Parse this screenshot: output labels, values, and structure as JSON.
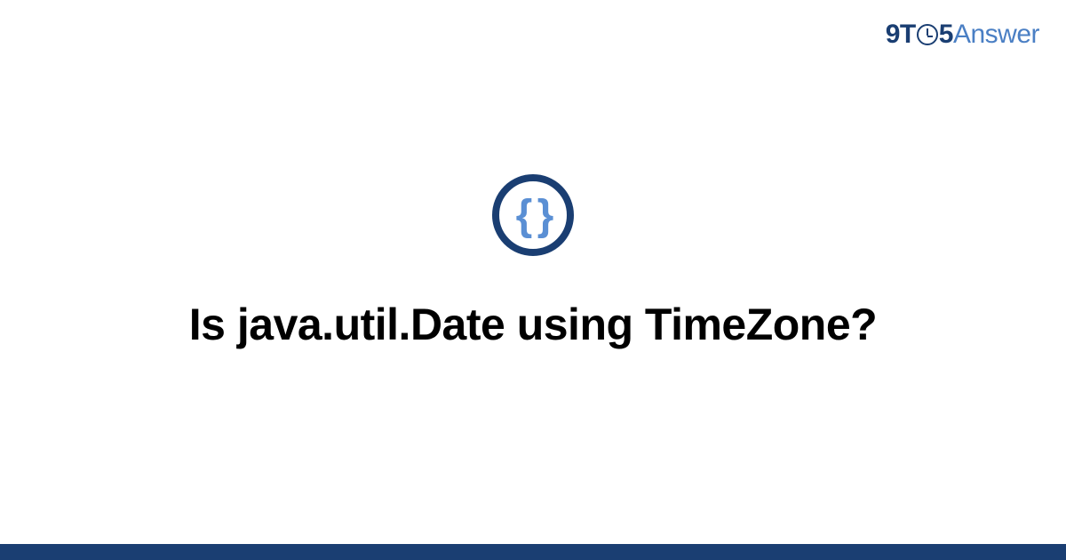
{
  "logo": {
    "part1": "9T",
    "part2": "5",
    "part3": "Answer"
  },
  "icon": {
    "braces": "{ }",
    "name": "code-braces"
  },
  "main": {
    "title": "Is java.util.Date using TimeZone?"
  },
  "colors": {
    "darkBlue": "#1a3e72",
    "lightBlue": "#4a7fc4",
    "braceBlue": "#5a8fd4"
  }
}
